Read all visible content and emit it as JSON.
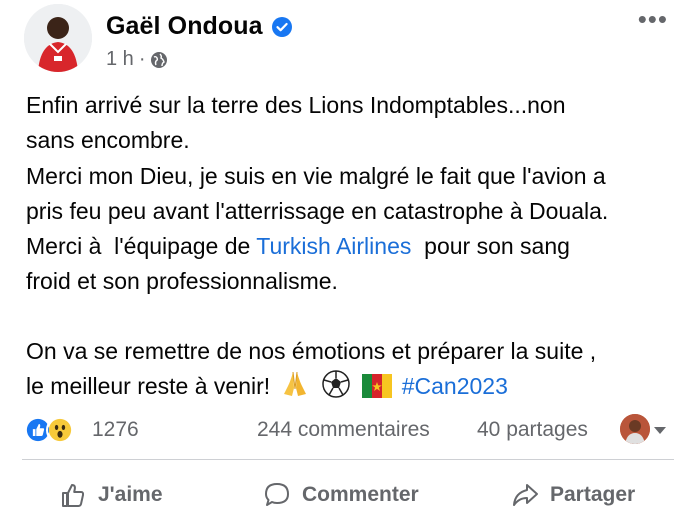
{
  "post": {
    "author": "Gaël Ondoua",
    "time": "1 h",
    "meta_sep": "·",
    "more": "•••",
    "text": {
      "line1": "Enfin arrivé sur la terre des Lions Indomptables...non",
      "line2": "sans encombre.",
      "line3": "Merci mon Dieu, je suis en vie malgré le fait que l'avion a",
      "line4": "pris feu peu avant l'atterrissage en catastrophe à Douala.",
      "line5_a": "Merci à  l'équipage de ",
      "line5_link": "Turkish Airlines",
      "line5_b": "  pour son sang",
      "line6": "froid et son professionnalisme.",
      "line7": "On va se remettre de nos émotions et préparer la suite ,",
      "line8_a": "le meilleur reste à venir!",
      "hashtag": "#Can2023"
    },
    "emojis": [
      "folded-hands",
      "soccer-ball",
      "cameroon-flag"
    ]
  },
  "stats": {
    "reactions_count": "1276",
    "comments": "244 commentaires",
    "shares": "40 partages"
  },
  "actions": {
    "like": "J'aime",
    "comment": "Commenter",
    "share": "Partager"
  },
  "colors": {
    "link": "#1a6ed8",
    "secondary_text": "#65676b",
    "verified": "#1877f2",
    "divider": "#ced0d4"
  }
}
